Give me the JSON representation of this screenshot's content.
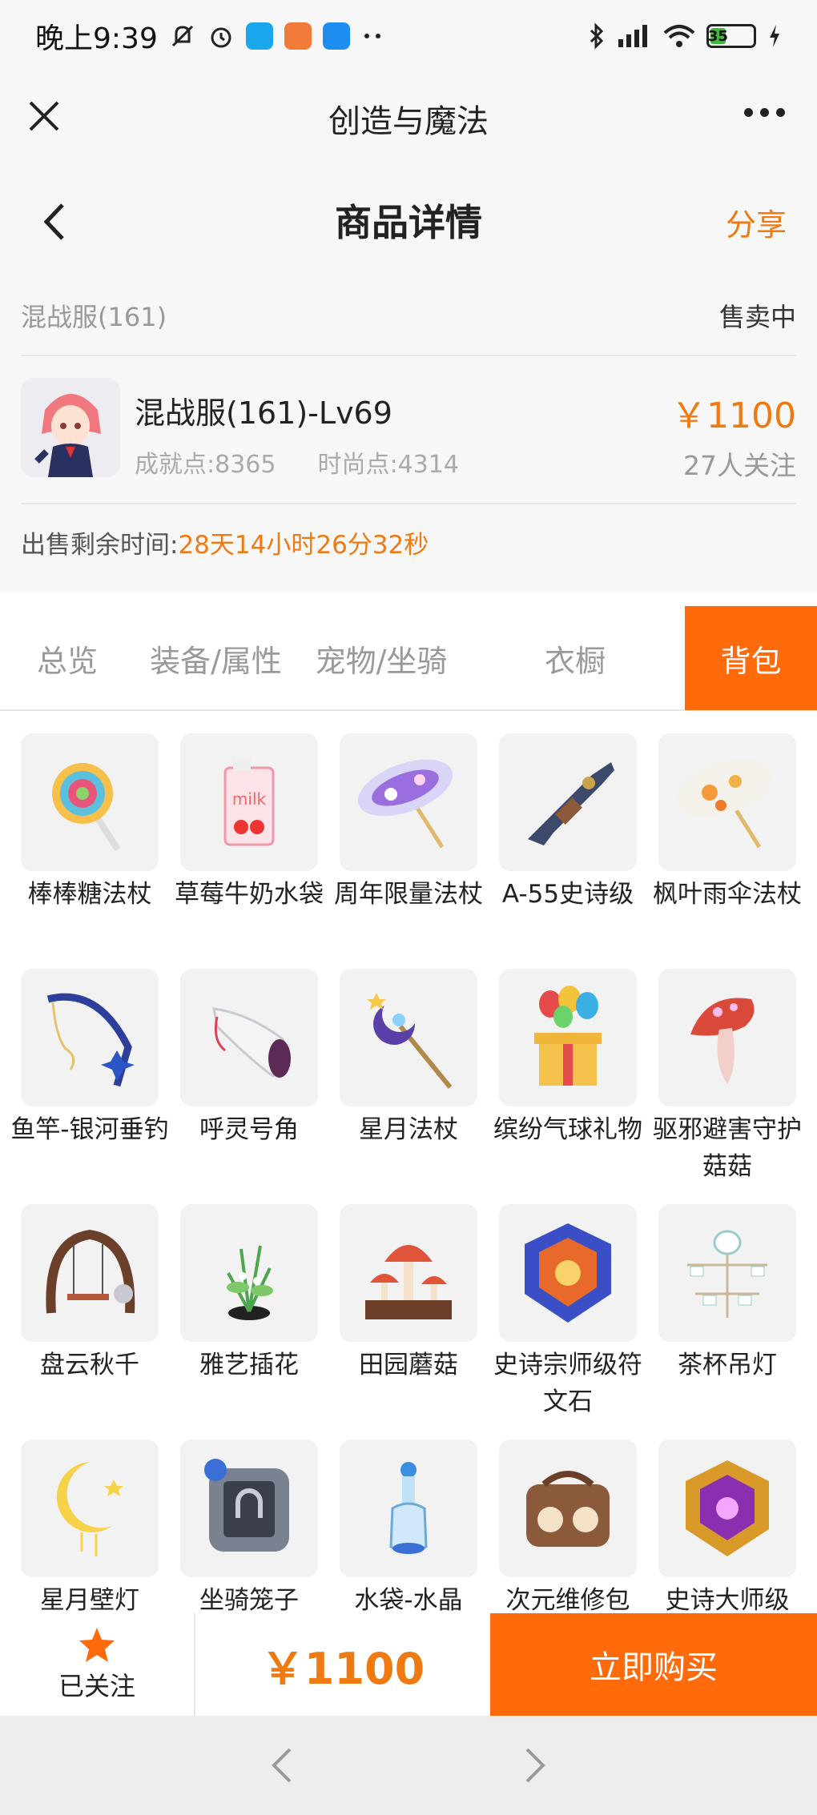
{
  "status_bar": {
    "time": "晚上9:39",
    "battery": "35"
  },
  "titlebar": {
    "title": "创造与魔法"
  },
  "header": {
    "title": "商品详情",
    "share": "分享"
  },
  "listing": {
    "server": "混战服(161)",
    "status": "售卖中",
    "name": "混战服(161)-Lv69",
    "achievement": "成就点:8365",
    "fashion": "时尚点:4314",
    "price": "￥1100",
    "followers": "27人关注",
    "timer_label": "出售剩余时间:",
    "timer_value": "28天14小时26分32秒"
  },
  "tabs": [
    {
      "label": "总览"
    },
    {
      "label": "装备/属性"
    },
    {
      "label": "宠物/坐骑"
    },
    {
      "label": "衣橱"
    },
    {
      "label": "背包"
    }
  ],
  "items": [
    {
      "name": "棒棒糖法杖",
      "icon": "lollipop-staff-icon"
    },
    {
      "name": "草莓牛奶水袋",
      "icon": "strawberry-milk-icon"
    },
    {
      "name": "周年限量法杖",
      "icon": "anniversary-umbrella-icon"
    },
    {
      "name": "A-55史诗级",
      "icon": "rifle-icon"
    },
    {
      "name": "枫叶雨伞法杖",
      "icon": "maple-umbrella-icon"
    },
    {
      "name": "鱼竿-银河垂钓",
      "icon": "fishing-rod-icon"
    },
    {
      "name": "呼灵号角",
      "icon": "horn-icon"
    },
    {
      "name": "星月法杖",
      "icon": "moon-staff-icon"
    },
    {
      "name": "缤纷气球礼物",
      "icon": "balloon-gift-icon"
    },
    {
      "name": "驱邪避害守护菇菇",
      "icon": "mushroom-guard-icon"
    },
    {
      "name": "盘云秋千",
      "icon": "swing-icon"
    },
    {
      "name": "雅艺插花",
      "icon": "flower-arrangement-icon"
    },
    {
      "name": "田园蘑菇",
      "icon": "garden-mushroom-icon"
    },
    {
      "name": "史诗宗师级符文石",
      "icon": "rune-stone-icon"
    },
    {
      "name": "茶杯吊灯",
      "icon": "teacup-chandelier-icon"
    },
    {
      "name": "星月壁灯",
      "icon": "moon-wall-lamp-icon"
    },
    {
      "name": "坐骑笼子",
      "icon": "mount-cage-icon"
    },
    {
      "name": "水袋-水晶",
      "icon": "crystal-flask-icon"
    },
    {
      "name": "次元维修包",
      "icon": "repair-bag-icon"
    },
    {
      "name": "史诗大师级",
      "icon": "epic-rune-icon"
    }
  ],
  "bottom": {
    "follow_label": "已关注",
    "price": "￥1100",
    "buy_label": "立即购买"
  },
  "colors": {
    "accent": "#ff6a0b",
    "price": "#ef7a12",
    "background": "#f7f7f7"
  }
}
